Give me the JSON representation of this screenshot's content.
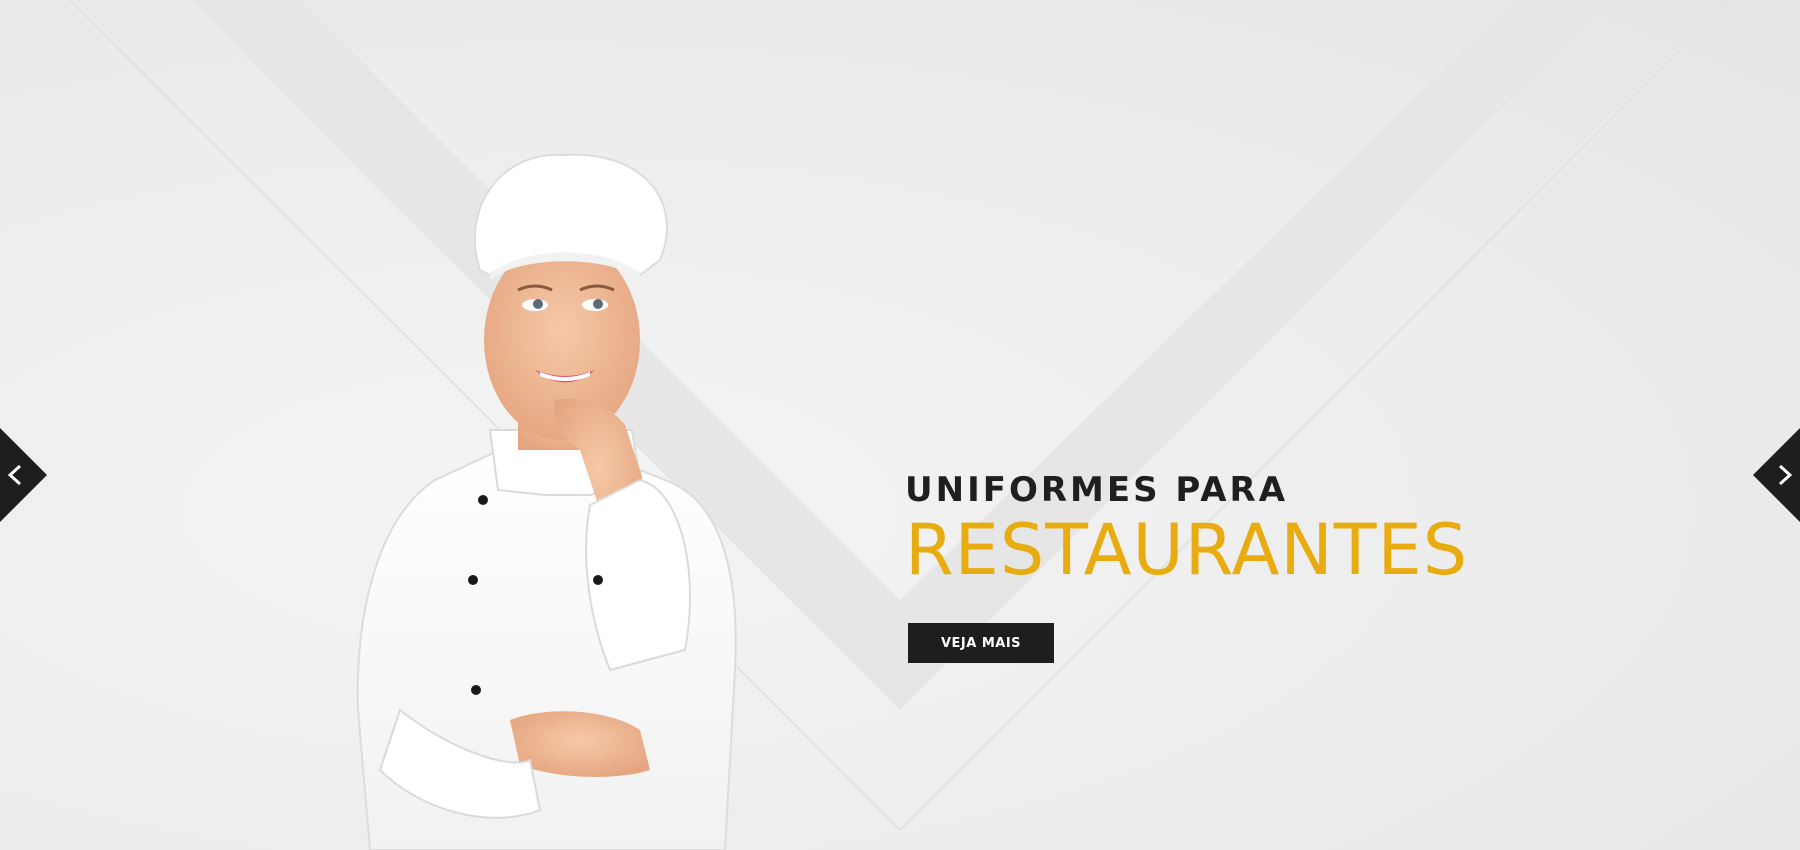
{
  "slider": {
    "headline_top": "UNIFORMES PARA",
    "headline_main": "RESTAURANTES",
    "cta_label": "VEJA MAIS",
    "prev_icon": "chevron-left-icon",
    "next_icon": "chevron-right-icon"
  },
  "colors": {
    "accent": "#e8ac10",
    "dark": "#1e1e1e",
    "background": "#efefef"
  }
}
